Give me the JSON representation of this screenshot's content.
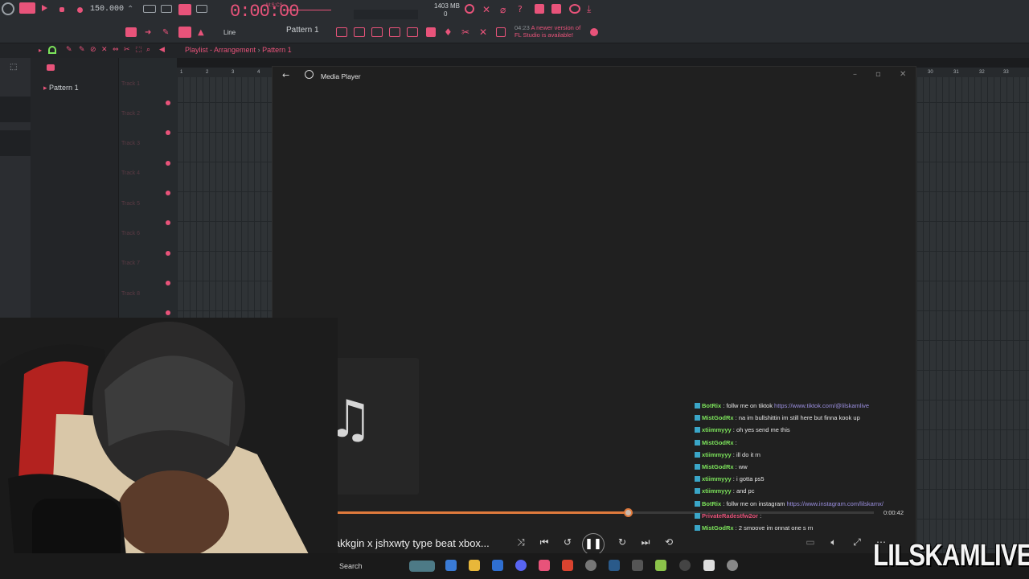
{
  "fl_studio": {
    "tempo": "150.000",
    "time": "0:00:00",
    "time_sub": "M:S:CS",
    "memory": "1403 MB",
    "cpu_val": "0",
    "pattern": "Pattern 1",
    "snap": "Line",
    "notice_time": "04:23",
    "notice": "A newer version of FL Studio is available!",
    "playlist_title": "Playlist - Arrangement",
    "playlist_pattern": "Pattern 1",
    "pattern_list_item": "Pattern 1",
    "tracks": [
      "Track 1",
      "Track 2",
      "Track 3",
      "Track 4",
      "Track 5",
      "Track 6",
      "Track 7",
      "Track 8"
    ],
    "ruler": [
      "1",
      "2",
      "3",
      "4",
      "30",
      "31",
      "32",
      "33"
    ]
  },
  "media_player": {
    "title": "Media Player",
    "track_title": "makkgin x jshxwty type beat xbox...",
    "elapsed": "0:00:42",
    "progress": 0.56
  },
  "chat": [
    {
      "user": "BotRix",
      "color": "#7ce35b",
      "text": " : follw me on tiktok ",
      "link": "https://www.tiktok.com/@lilskamlive"
    },
    {
      "user": "MistGodRx",
      "color": "#7ce35b",
      "text": " : na im bullshittin im still here but finna kook up",
      "link": ""
    },
    {
      "user": "xtiimmyyy",
      "color": "#7ce35b",
      "text": " : oh yes send me this",
      "link": ""
    },
    {
      "user": "MistGodRx",
      "color": "#7ce35b",
      "text": " : ",
      "link": ""
    },
    {
      "user": "xtiimmyyy",
      "color": "#7ce35b",
      "text": " : ill do it rn",
      "link": ""
    },
    {
      "user": "MistGodRx",
      "color": "#7ce35b",
      "text": " : ww",
      "link": ""
    },
    {
      "user": "xtiimmyyy",
      "color": "#7ce35b",
      "text": " : i gotta ps5",
      "link": ""
    },
    {
      "user": "xtiimmyyy",
      "color": "#7ce35b",
      "text": " : and pc",
      "link": ""
    },
    {
      "user": "BotRix",
      "color": "#7ce35b",
      "text": " : follw me on instagram ",
      "link": "https://www.instagram.com/lilskamx/"
    },
    {
      "user": "PrivateRadestfw2or",
      "color": "#e8537a",
      "text": " : ",
      "link": ""
    },
    {
      "user": "MistGodRx",
      "color": "#7ce35b",
      "text": " : 2 smoove im onnat one s rn",
      "link": ""
    }
  ],
  "taskbar": {
    "search_placeholder": "Search"
  },
  "overlay": {
    "brand": "LILSKAMLIVE"
  }
}
